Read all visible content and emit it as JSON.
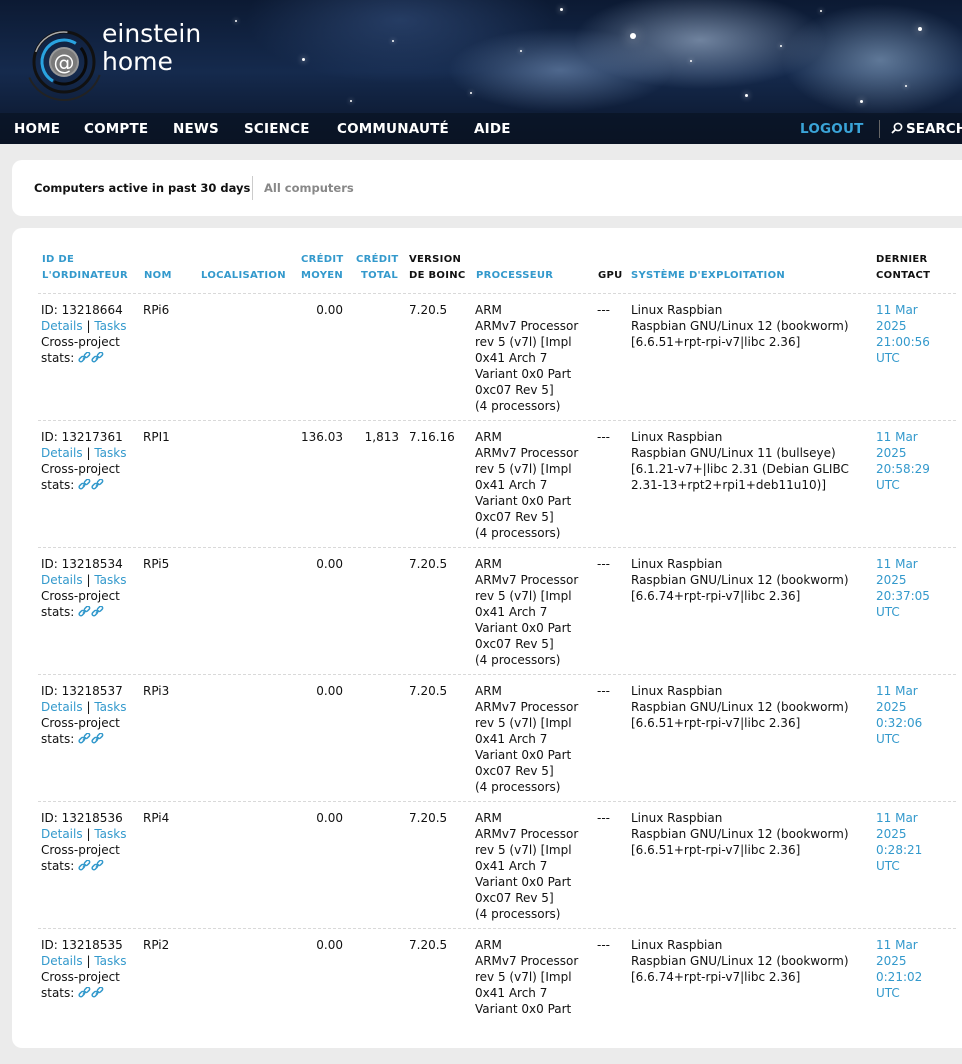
{
  "brand": {
    "line1": "einstein",
    "line2": "home",
    "at": "@"
  },
  "nav": {
    "items": [
      "HOME",
      "COMPTE",
      "NEWS",
      "SCIENCE",
      "COMMUNAUTÉ",
      "AIDE"
    ],
    "logout": "LOGOUT",
    "search": "SEARCH"
  },
  "tabs": {
    "active": "Computers active in past 30 days",
    "inactive": "All computers"
  },
  "table": {
    "headers": {
      "id": [
        "ID DE",
        "L'ORDINATEUR"
      ],
      "name": "NOM",
      "location": "LOCALISATION",
      "avg_credit": [
        "CRÉDIT",
        "MOYEN"
      ],
      "total_credit": [
        "CRÉDIT",
        "TOTAL"
      ],
      "boinc_version": [
        "VERSION",
        "DE BOINC"
      ],
      "processor": "PROCESSEUR",
      "gpu": "GPU",
      "os": "SYSTÈME D'EXPLOITATION",
      "last_contact": [
        "DERNIER",
        "CONTACT"
      ]
    },
    "link_details": "Details",
    "link_tasks": "Tasks",
    "pipe": "|",
    "cross_project": [
      "Cross-project",
      "stats:"
    ],
    "rows": [
      {
        "id": "ID: 13218664",
        "name": "RPi6",
        "location": "",
        "avg_credit": "0.00",
        "total_credit": "",
        "boinc": "7.20.5",
        "processor": [
          "ARM",
          "ARMv7 Processor",
          "rev 5 (v7l) [Impl",
          "0x41 Arch 7",
          "Variant 0x0 Part",
          "0xc07 Rev 5]",
          "(4 processors)"
        ],
        "gpu": "---",
        "os": [
          "Linux Raspbian",
          "Raspbian GNU/Linux 12 (bookworm)",
          "[6.6.51+rpt-rpi-v7|libc 2.36]"
        ],
        "last_contact": [
          "11 Mar",
          "2025",
          "21:00:56",
          "UTC"
        ]
      },
      {
        "id": "ID: 13217361",
        "name": "RPI1",
        "location": "",
        "avg_credit": "136.03",
        "total_credit": "1,813",
        "boinc": "7.16.16",
        "processor": [
          "ARM",
          "ARMv7 Processor",
          "rev 5 (v7l) [Impl",
          "0x41 Arch 7",
          "Variant 0x0 Part",
          "0xc07 Rev 5]",
          "(4 processors)"
        ],
        "gpu": "---",
        "os": [
          "Linux Raspbian",
          "Raspbian GNU/Linux 11 (bullseye)",
          "[6.1.21-v7+|libc 2.31 (Debian GLIBC",
          "2.31-13+rpt2+rpi1+deb11u10)]"
        ],
        "last_contact": [
          "11 Mar",
          "2025",
          "20:58:29",
          "UTC"
        ]
      },
      {
        "id": "ID: 13218534",
        "name": "RPi5",
        "location": "",
        "avg_credit": "0.00",
        "total_credit": "",
        "boinc": "7.20.5",
        "processor": [
          "ARM",
          "ARMv7 Processor",
          "rev 5 (v7l) [Impl",
          "0x41 Arch 7",
          "Variant 0x0 Part",
          "0xc07 Rev 5]",
          "(4 processors)"
        ],
        "gpu": "---",
        "os": [
          "Linux Raspbian",
          "Raspbian GNU/Linux 12 (bookworm)",
          "[6.6.74+rpt-rpi-v7|libc 2.36]"
        ],
        "last_contact": [
          "11 Mar",
          "2025",
          "20:37:05",
          "UTC"
        ]
      },
      {
        "id": "ID: 13218537",
        "name": "RPi3",
        "location": "",
        "avg_credit": "0.00",
        "total_credit": "",
        "boinc": "7.20.5",
        "processor": [
          "ARM",
          "ARMv7 Processor",
          "rev 5 (v7l) [Impl",
          "0x41 Arch 7",
          "Variant 0x0 Part",
          "0xc07 Rev 5]",
          "(4 processors)"
        ],
        "gpu": "---",
        "os": [
          "Linux Raspbian",
          "Raspbian GNU/Linux 12 (bookworm)",
          "[6.6.51+rpt-rpi-v7|libc 2.36]"
        ],
        "last_contact": [
          "11 Mar",
          "2025",
          "0:32:06",
          "UTC"
        ]
      },
      {
        "id": "ID: 13218536",
        "name": "RPi4",
        "location": "",
        "avg_credit": "0.00",
        "total_credit": "",
        "boinc": "7.20.5",
        "processor": [
          "ARM",
          "ARMv7 Processor",
          "rev 5 (v7l) [Impl",
          "0x41 Arch 7",
          "Variant 0x0 Part",
          "0xc07 Rev 5]",
          "(4 processors)"
        ],
        "gpu": "---",
        "os": [
          "Linux Raspbian",
          "Raspbian GNU/Linux 12 (bookworm)",
          "[6.6.51+rpt-rpi-v7|libc 2.36]"
        ],
        "last_contact": [
          "11 Mar",
          "2025",
          "0:28:21",
          "UTC"
        ]
      },
      {
        "id": "ID: 13218535",
        "name": "RPi2",
        "location": "",
        "avg_credit": "0.00",
        "total_credit": "",
        "boinc": "7.20.5",
        "processor": [
          "ARM",
          "ARMv7 Processor",
          "rev 5 (v7l) [Impl",
          "0x41 Arch 7",
          "Variant 0x0 Part"
        ],
        "gpu": "---",
        "os": [
          "Linux Raspbian",
          "Raspbian GNU/Linux 12 (bookworm)",
          "[6.6.74+rpt-rpi-v7|libc 2.36]"
        ],
        "last_contact": [
          "11 Mar",
          "2025",
          "0:21:02",
          "UTC"
        ]
      }
    ]
  },
  "colors": {
    "link": "#3399cc",
    "logout": "#3aa4d8",
    "page_bg": "#ebebeb"
  },
  "icons": {
    "logo": "einstein-at-home-logo",
    "search": "magnifier-icon",
    "stats": "link-chain-icon"
  }
}
